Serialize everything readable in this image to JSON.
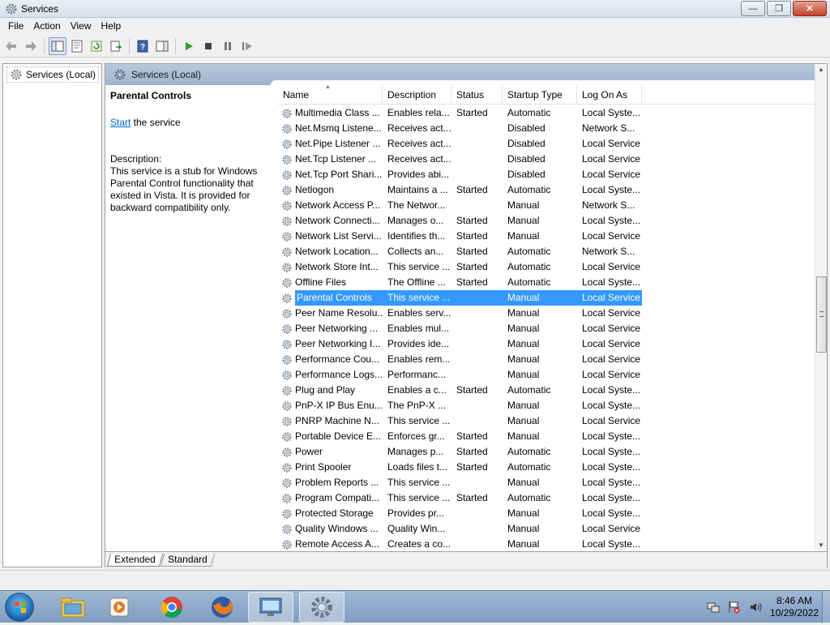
{
  "window": {
    "title": "Services",
    "icons": {
      "app": "services-gear-icon",
      "minimize": "minimize-icon",
      "maximize": "restore-icon",
      "close": "close-icon"
    }
  },
  "menu": [
    "File",
    "Action",
    "View",
    "Help"
  ],
  "toolbar": {
    "buttons": [
      "back-icon",
      "forward-icon",
      "show-hide-tree-icon",
      "properties-icon",
      "refresh-icon",
      "export-list-icon",
      "help-icon",
      "show-hide-action-pane-icon",
      "start-service-icon",
      "stop-service-icon",
      "pause-service-icon",
      "restart-service-icon"
    ]
  },
  "tree": {
    "item": "Services (Local)"
  },
  "main": {
    "header": "Services (Local)",
    "description_pane": {
      "title": "Parental Controls",
      "start_link": "Start",
      "start_suffix": " the service",
      "description_label": "Description:",
      "description_text": "This service is a stub for Windows Parental Control functionality that existed in Vista. It is provided for backward compatibility only."
    },
    "columns": [
      "Name",
      "Description",
      "Status",
      "Startup Type",
      "Log On As"
    ],
    "rows": [
      {
        "name": "Multimedia Class ...",
        "desc": "Enables rela...",
        "status": "Started",
        "startup": "Automatic",
        "logon": "Local Syste..."
      },
      {
        "name": "Net.Msmq Listene...",
        "desc": "Receives act...",
        "status": "",
        "startup": "Disabled",
        "logon": "Network S..."
      },
      {
        "name": "Net.Pipe Listener ...",
        "desc": "Receives act...",
        "status": "",
        "startup": "Disabled",
        "logon": "Local Service"
      },
      {
        "name": "Net.Tcp Listener ...",
        "desc": "Receives act...",
        "status": "",
        "startup": "Disabled",
        "logon": "Local Service"
      },
      {
        "name": "Net.Tcp Port Shari...",
        "desc": "Provides abi...",
        "status": "",
        "startup": "Disabled",
        "logon": "Local Service"
      },
      {
        "name": "Netlogon",
        "desc": "Maintains a ...",
        "status": "Started",
        "startup": "Automatic",
        "logon": "Local Syste..."
      },
      {
        "name": "Network Access P...",
        "desc": "The Networ...",
        "status": "",
        "startup": "Manual",
        "logon": "Network S..."
      },
      {
        "name": "Network Connecti...",
        "desc": "Manages o...",
        "status": "Started",
        "startup": "Manual",
        "logon": "Local Syste..."
      },
      {
        "name": "Network List Servi...",
        "desc": "Identifies th...",
        "status": "Started",
        "startup": "Manual",
        "logon": "Local Service"
      },
      {
        "name": "Network Location...",
        "desc": "Collects an...",
        "status": "Started",
        "startup": "Automatic",
        "logon": "Network S..."
      },
      {
        "name": "Network Store Int...",
        "desc": "This service ...",
        "status": "Started",
        "startup": "Automatic",
        "logon": "Local Service"
      },
      {
        "name": "Offline Files",
        "desc": "The Offline ...",
        "status": "Started",
        "startup": "Automatic",
        "logon": "Local Syste..."
      },
      {
        "name": "Parental Controls",
        "desc": "This service ...",
        "status": "",
        "startup": "Manual",
        "logon": "Local Service",
        "selected": true
      },
      {
        "name": "Peer Name Resolu...",
        "desc": "Enables serv...",
        "status": "",
        "startup": "Manual",
        "logon": "Local Service"
      },
      {
        "name": "Peer Networking ...",
        "desc": "Enables mul...",
        "status": "",
        "startup": "Manual",
        "logon": "Local Service"
      },
      {
        "name": "Peer Networking I...",
        "desc": "Provides ide...",
        "status": "",
        "startup": "Manual",
        "logon": "Local Service"
      },
      {
        "name": "Performance Cou...",
        "desc": "Enables rem...",
        "status": "",
        "startup": "Manual",
        "logon": "Local Service"
      },
      {
        "name": "Performance Logs...",
        "desc": "Performanc...",
        "status": "",
        "startup": "Manual",
        "logon": "Local Service"
      },
      {
        "name": "Plug and Play",
        "desc": "Enables a c...",
        "status": "Started",
        "startup": "Automatic",
        "logon": "Local Syste..."
      },
      {
        "name": "PnP-X IP Bus Enu...",
        "desc": "The PnP-X ...",
        "status": "",
        "startup": "Manual",
        "logon": "Local Syste..."
      },
      {
        "name": "PNRP Machine N...",
        "desc": "This service ...",
        "status": "",
        "startup": "Manual",
        "logon": "Local Service"
      },
      {
        "name": "Portable Device E...",
        "desc": "Enforces gr...",
        "status": "Started",
        "startup": "Manual",
        "logon": "Local Syste..."
      },
      {
        "name": "Power",
        "desc": "Manages p...",
        "status": "Started",
        "startup": "Automatic",
        "logon": "Local Syste..."
      },
      {
        "name": "Print Spooler",
        "desc": "Loads files t...",
        "status": "Started",
        "startup": "Automatic",
        "logon": "Local Syste..."
      },
      {
        "name": "Problem Reports ...",
        "desc": "This service ...",
        "status": "",
        "startup": "Manual",
        "logon": "Local Syste..."
      },
      {
        "name": "Program Compati...",
        "desc": "This service ...",
        "status": "Started",
        "startup": "Automatic",
        "logon": "Local Syste..."
      },
      {
        "name": "Protected Storage",
        "desc": "Provides pr...",
        "status": "",
        "startup": "Manual",
        "logon": "Local Syste..."
      },
      {
        "name": "Quality Windows ...",
        "desc": "Quality Win...",
        "status": "",
        "startup": "Manual",
        "logon": "Local Service"
      },
      {
        "name": "Remote Access A...",
        "desc": "Creates a co...",
        "status": "",
        "startup": "Manual",
        "logon": "Local Syste..."
      }
    ],
    "tabs": [
      "Extended",
      "Standard"
    ]
  },
  "taskbar": {
    "pinned": [
      "windows-explorer-icon",
      "media-player-icon",
      "chrome-icon",
      "firefox-icon",
      "remote-desktop-icon",
      "services-gear-icon"
    ],
    "tray_icons": [
      "network-icon",
      "action-center-icon",
      "volume-icon"
    ],
    "clock_time": "8:46 AM",
    "clock_date": "10/29/2022"
  },
  "colors": {
    "selection": "#3399ff",
    "link": "#0066cc",
    "header_band": "#b8c9dd"
  }
}
